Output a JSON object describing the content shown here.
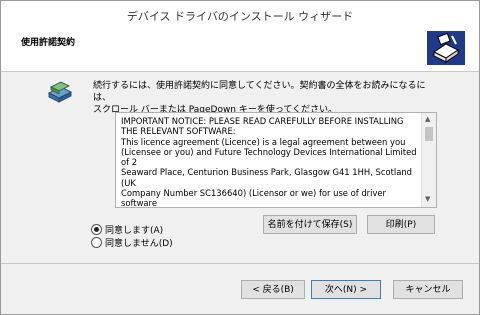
{
  "window": {
    "title": "デバイス ドライバのインストール ウィザード"
  },
  "header": {
    "heading": "使用許諾契約"
  },
  "intro": {
    "line1": "続行するには、使用許諾契約に同意してください。契約書の全体をお読みになるには、",
    "line2": "スクロール バーまたは PageDown キーを使ってください。"
  },
  "license": {
    "text": "IMPORTANT NOTICE: PLEASE READ CAREFULLY BEFORE INSTALLING\nTHE RELEVANT SOFTWARE:\nThis licence agreement (Licence) is a legal agreement between you\n(Licensee or you) and Future Technology Devices International Limited of 2\nSeaward Place, Centurion Business Park, Glasgow G41 1HH, Scotland (UK\nCompany Number SC136640) (Licensor or we) for use of driver software\nprovided by the Licensor(Software).\n\nBY INSTALLING OR USING THIS SOFTWARE YOU AGREE TO THE TERMS"
  },
  "options": {
    "agree": "同意します(A)",
    "disagree": "同意しません(D)",
    "selected": "agree"
  },
  "buttons": {
    "save": "名前を付けて保存(S)",
    "print": "印刷(P)",
    "back": "< 戻る(B)",
    "next": "次へ(N) >",
    "cancel": "キャンセル"
  }
}
